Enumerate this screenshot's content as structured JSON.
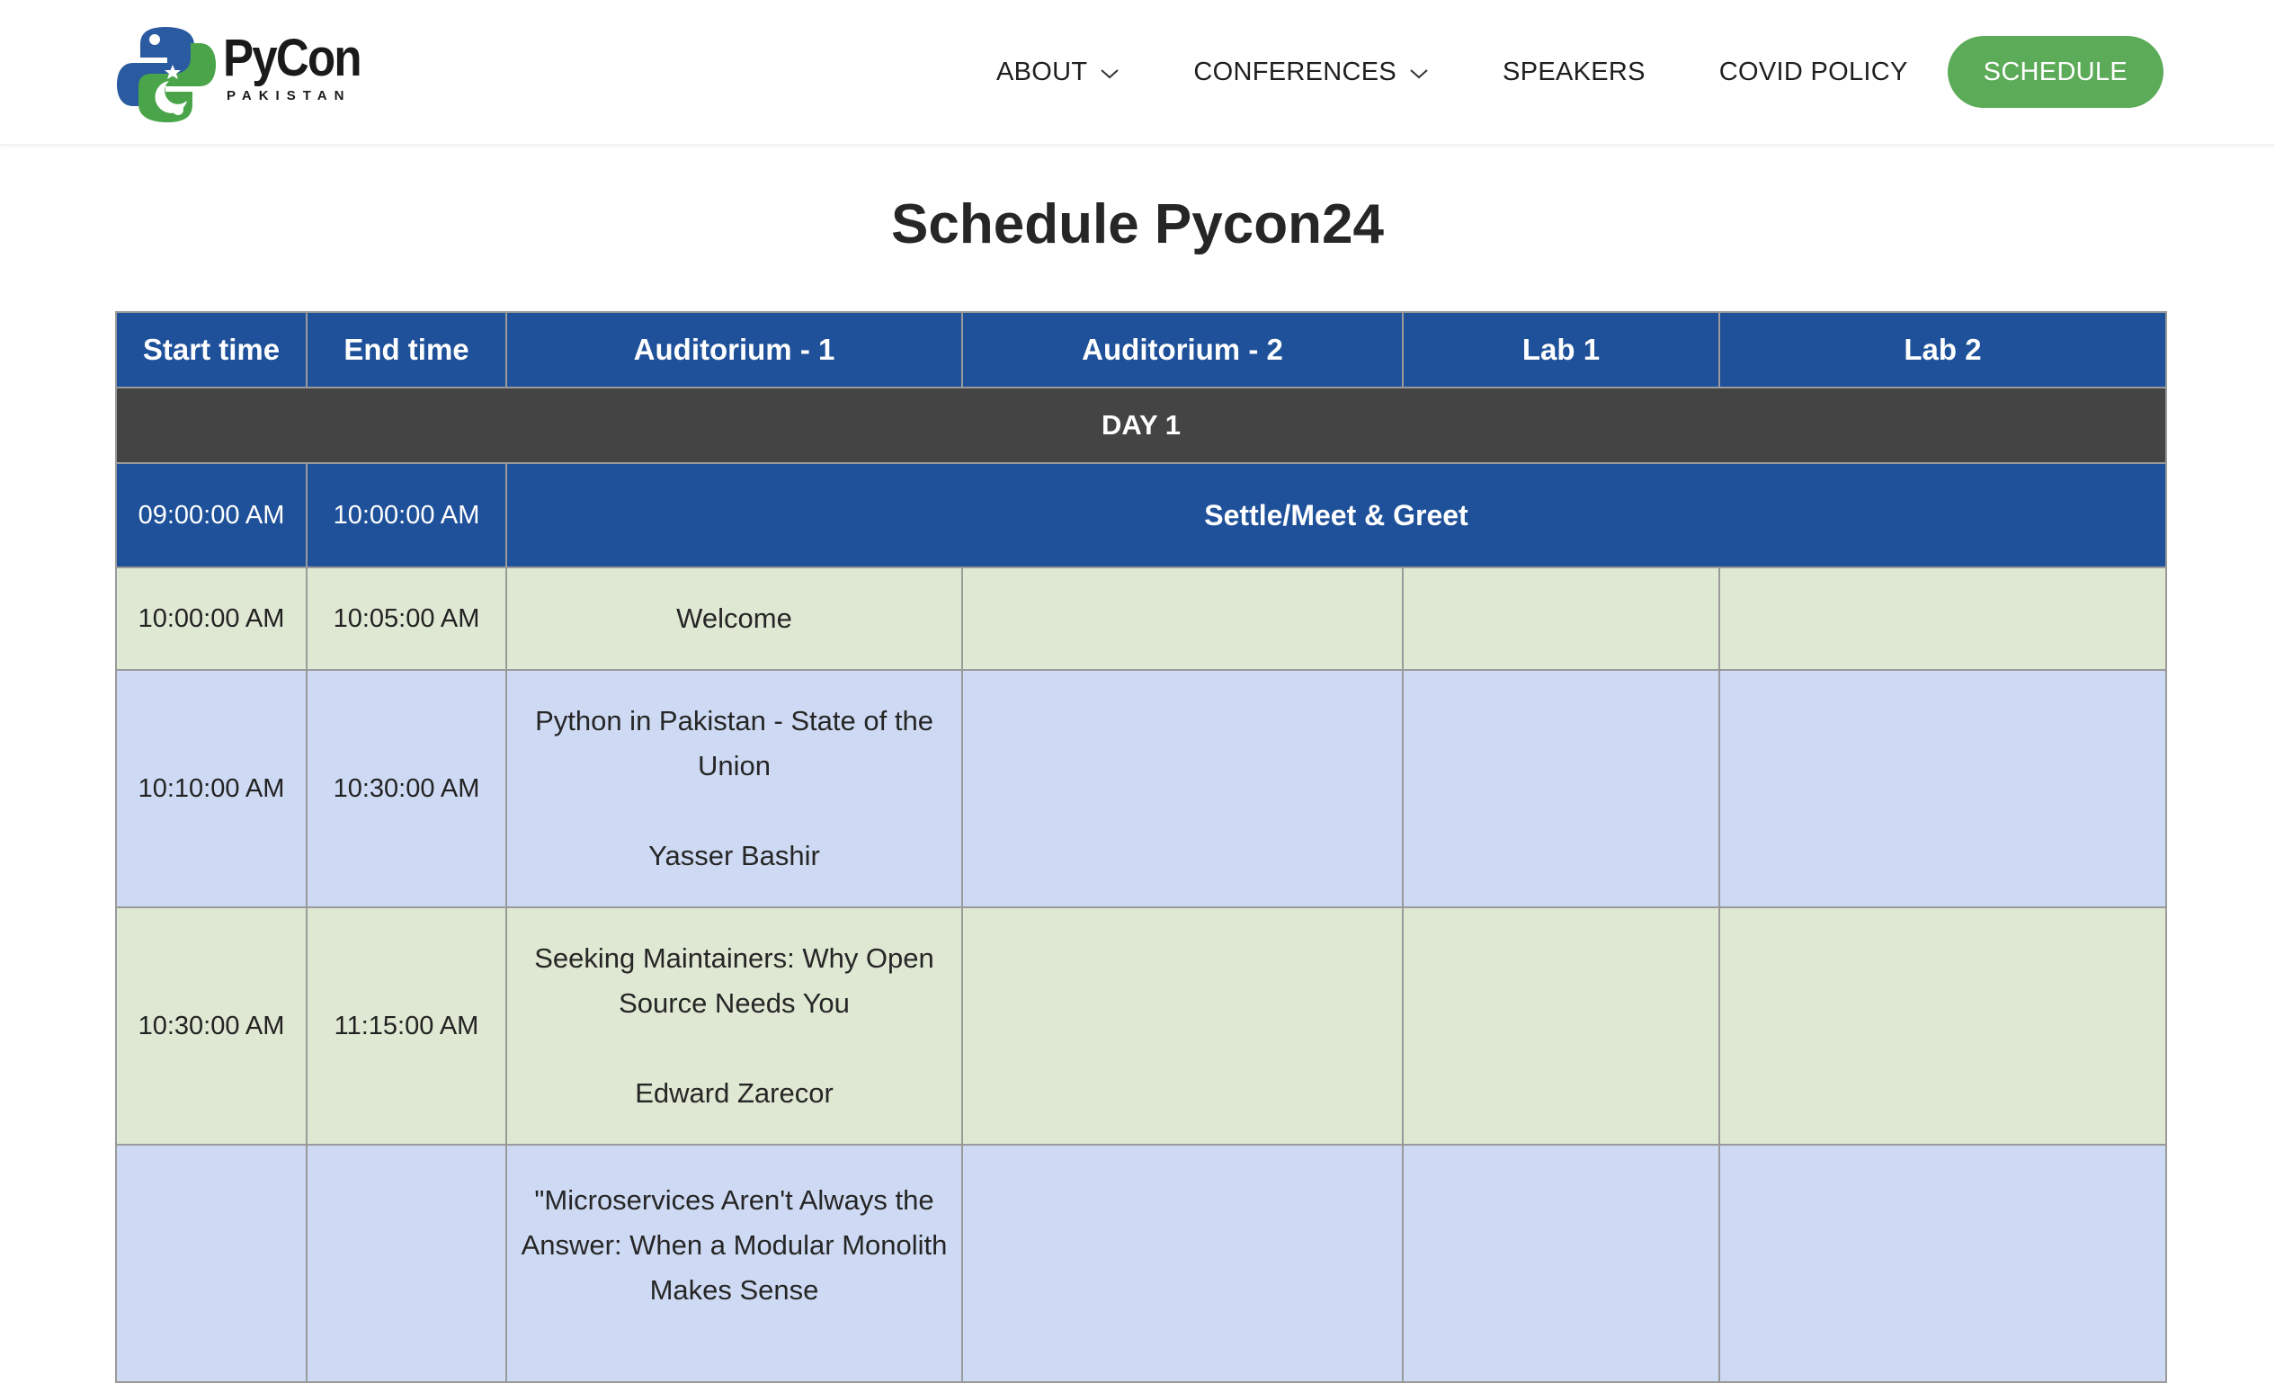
{
  "logo": {
    "name": "PyCon",
    "subtitle": "PAKISTAN"
  },
  "nav": {
    "items": [
      {
        "label": "ABOUT",
        "has_dropdown": true
      },
      {
        "label": "CONFERENCES",
        "has_dropdown": true
      },
      {
        "label": "SPEAKERS",
        "has_dropdown": false
      },
      {
        "label": "COVID POLICY",
        "has_dropdown": false
      }
    ],
    "cta": "SCHEDULE"
  },
  "page_title": "Schedule Pycon24",
  "table": {
    "headers": [
      "Start time",
      "End time",
      "Auditorium - 1",
      "Auditorium - 2",
      "Lab 1",
      "Lab 2"
    ],
    "day_label": "DAY 1",
    "rows": [
      {
        "start": "09:00:00 AM",
        "end": "10:00:00 AM",
        "event": "Settle/Meet & Greet"
      },
      {
        "start": "10:00:00 AM",
        "end": "10:05:00 AM",
        "aud1_title": "Welcome"
      },
      {
        "start": "10:10:00 AM",
        "end": "10:30:00 AM",
        "aud1_title": "Python in Pakistan - State of the Union",
        "aud1_speaker": "Yasser Bashir"
      },
      {
        "start": "10:30:00 AM",
        "end": "11:15:00 AM",
        "aud1_title": "Seeking Maintainers: Why Open Source Needs You",
        "aud1_speaker": "Edward Zarecor"
      },
      {
        "start": "",
        "end": "",
        "aud1_title": "\"Microservices Aren't Always the Answer: When a Modular Monolith Makes Sense"
      }
    ]
  },
  "colors": {
    "header_blue": "#1f519a",
    "day_row": "#444444",
    "row_green": "#dee8d2",
    "row_light_blue": "#cedaf3",
    "cta_green": "#5cab58"
  }
}
